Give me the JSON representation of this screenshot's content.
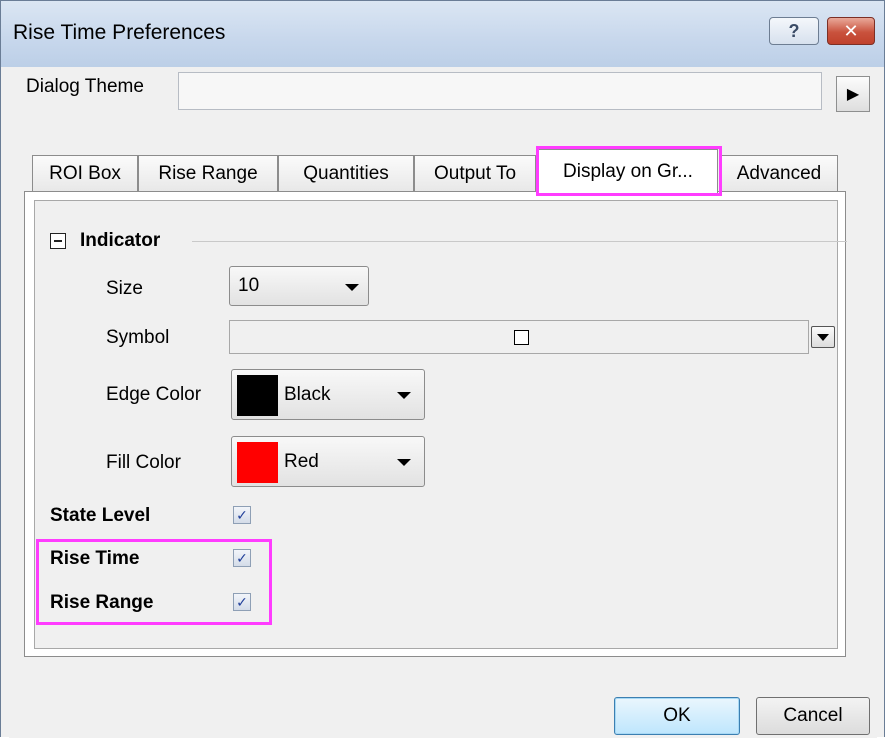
{
  "window": {
    "title": "Rise Time Preferences",
    "help_button": "?",
    "close_button": "✕"
  },
  "theme": {
    "label": "Dialog Theme",
    "value": "",
    "menu_arrow": "▶"
  },
  "tabs": [
    {
      "label": "ROI Box",
      "active": false
    },
    {
      "label": "Rise Range",
      "active": false
    },
    {
      "label": "Quantities",
      "active": false
    },
    {
      "label": "Output To",
      "active": false
    },
    {
      "label": "Display on Gr...",
      "active": true
    },
    {
      "label": "Advanced",
      "active": false
    }
  ],
  "indicator": {
    "title": "Indicator",
    "size": {
      "label": "Size",
      "value": "10"
    },
    "symbol": {
      "label": "Symbol"
    },
    "edge_color": {
      "label": "Edge Color",
      "value": "Black",
      "swatch": "#000000"
    },
    "fill_color": {
      "label": "Fill Color",
      "value": "Red",
      "swatch": "#ff0000"
    }
  },
  "options": {
    "state_level": {
      "label": "State Level",
      "checked": true
    },
    "rise_time": {
      "label": "Rise Time",
      "checked": true
    },
    "rise_range": {
      "label": "Rise Range",
      "checked": true
    }
  },
  "check_glyph": "✓",
  "buttons": {
    "ok": "OK",
    "cancel": "Cancel"
  },
  "colors": {
    "highlight": "#ff3cff"
  }
}
